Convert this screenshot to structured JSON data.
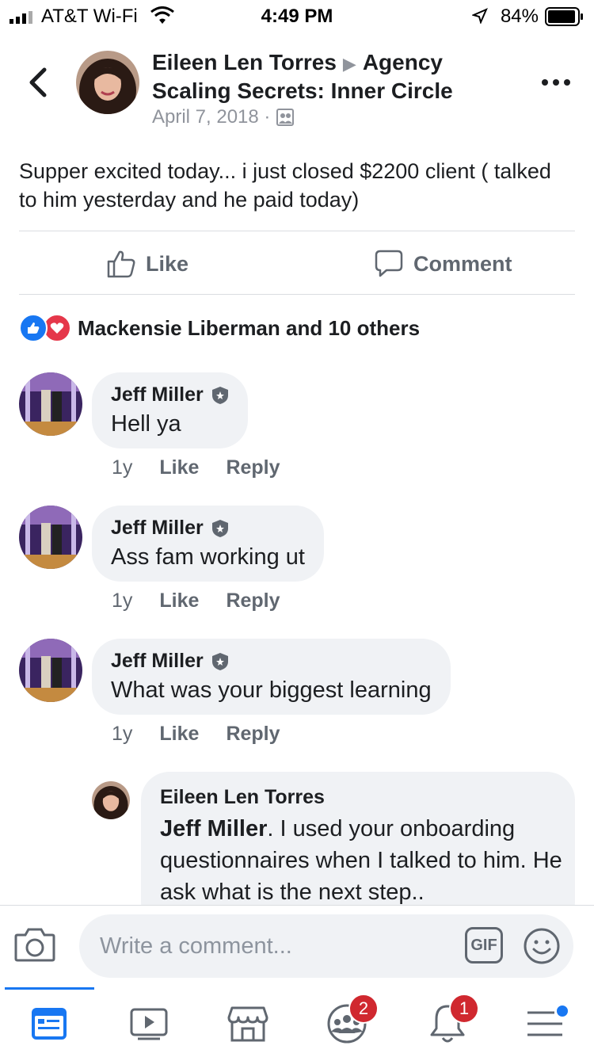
{
  "status_bar": {
    "carrier": "AT&T Wi-Fi",
    "time": "4:49 PM",
    "battery": "84%"
  },
  "post": {
    "author": "Eileen Len Torres",
    "group": "Agency Scaling Secrets: Inner Circle",
    "date": "April 7, 2018 ·",
    "text": "Supper excited today... i just closed $2200 client ( talked to him yesterday and he paid today)"
  },
  "actions": {
    "like": "Like",
    "comment": "Comment"
  },
  "reactions": {
    "text": "Mackensie Liberman and 10 others"
  },
  "comments": [
    {
      "name": "Jeff Miller",
      "text": "Hell ya",
      "time": "1y",
      "like": "Like",
      "reply": "Reply"
    },
    {
      "name": "Jeff Miller",
      "text": "Ass fam working ut",
      "time": "1y",
      "like": "Like",
      "reply": "Reply"
    },
    {
      "name": "Jeff Miller",
      "text": "What was your biggest learning",
      "time": "1y",
      "like": "Like",
      "reply": "Reply"
    }
  ],
  "reply": {
    "name": "Eileen Len Torres",
    "mention": "Jeff Miller",
    "text": ". I used your onboarding questionnaires when I talked to him. He ask what is the next step.."
  },
  "composer": {
    "placeholder": "Write a comment...",
    "gif": "GIF"
  },
  "tabs": {
    "groups_badge": "2",
    "notifications_badge": "1"
  },
  "colors": {
    "accent": "#1877f2",
    "badge": "#d0282f",
    "bubble": "#f0f2f5"
  }
}
